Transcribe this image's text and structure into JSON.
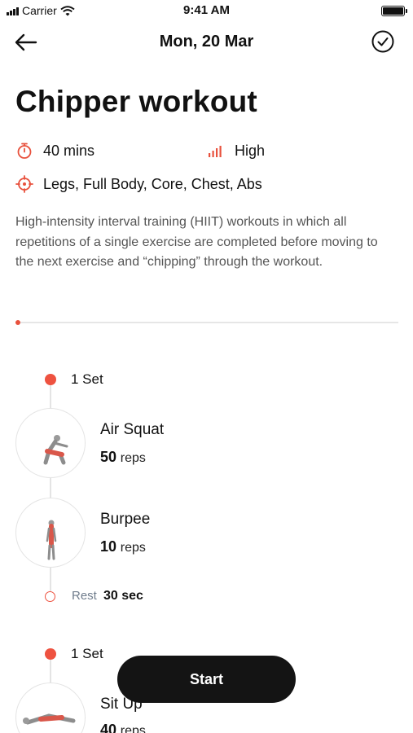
{
  "status_bar": {
    "carrier": "Carrier",
    "time": "9:41 AM"
  },
  "nav": {
    "title": "Mon, 20 Mar"
  },
  "workout": {
    "title": "Chipper workout",
    "duration": "40 mins",
    "intensity": "High",
    "targets": "Legs, Full Body, Core, Chest, Abs",
    "description": "High-intensity interval training (HIIT) workouts in which all repetitions of a single exercise are completed before moving to the next exercise and “chipping” through the workout."
  },
  "progress": {
    "value": 0
  },
  "sets": [
    {
      "label": "1 Set",
      "exercises": [
        {
          "name": "Air Squat",
          "reps": "50",
          "unit": "reps"
        },
        {
          "name": "Burpee",
          "reps": "10",
          "unit": "reps"
        }
      ],
      "rest": {
        "label": "Rest",
        "value": "30 sec"
      }
    },
    {
      "label": "1 Set",
      "exercises": [
        {
          "name": "Sit Up",
          "reps": "40",
          "unit": "reps"
        }
      ]
    }
  ],
  "start_button": {
    "label": "Start"
  },
  "colors": {
    "accent": "#ee5240",
    "button": "#141414"
  },
  "icons": [
    "back-arrow-icon",
    "check-circle-icon",
    "stopwatch-icon",
    "intensity-bars-icon",
    "target-icon",
    "wifi-icon",
    "signal-icon",
    "battery-icon"
  ]
}
